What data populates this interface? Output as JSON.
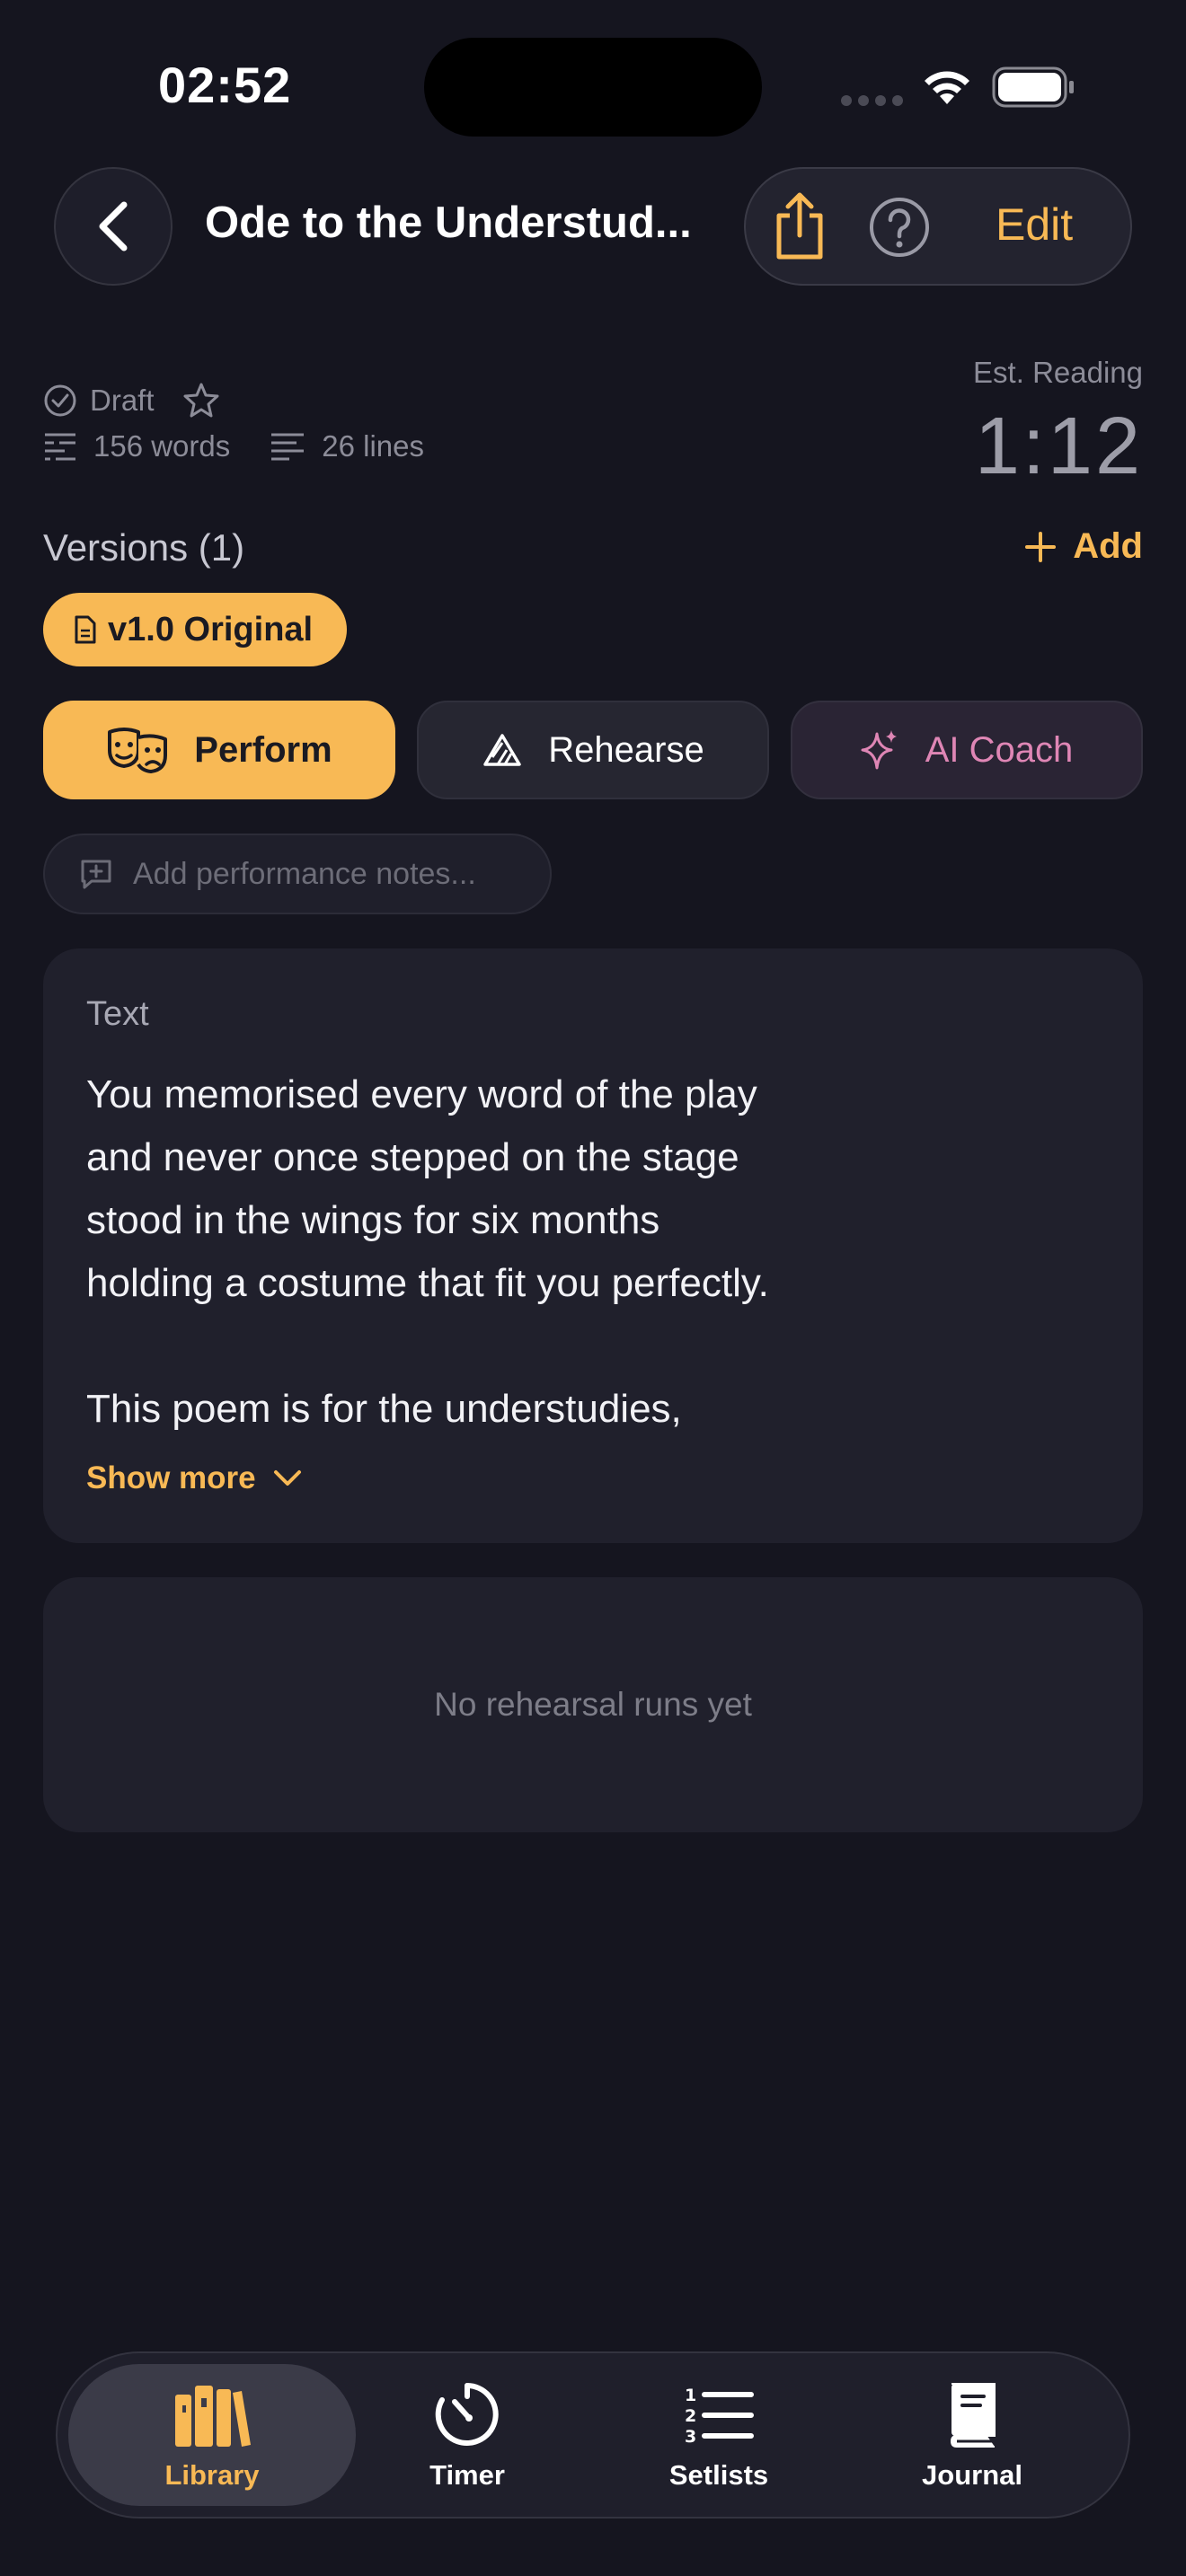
{
  "status_bar": {
    "time": "02:52"
  },
  "nav": {
    "title": "Ode to the Understud...",
    "edit_label": "Edit"
  },
  "meta": {
    "status": "Draft",
    "words": "156 words",
    "lines": "26 lines",
    "est_reading_label": "Est. Reading",
    "est_reading_value": "1:12"
  },
  "versions": {
    "title": "Versions (1)",
    "add_label": "Add",
    "items": [
      {
        "label": "v1.0 Original"
      }
    ]
  },
  "actions": {
    "perform": "Perform",
    "rehearse": "Rehearse",
    "ai_coach": "AI Coach"
  },
  "notes_placeholder": "Add performance notes...",
  "text_card": {
    "label": "Text",
    "lines": [
      "You memorised every word of the play",
      "and never once stepped on the stage",
      "stood in the wings for six months",
      "holding a costume that fit you perfectly.",
      "",
      "This poem is for the understudies,"
    ],
    "show_more": "Show more"
  },
  "runs_empty": "No rehearsal runs yet",
  "tabbar": {
    "items": [
      {
        "label": "Library",
        "icon": "books-icon",
        "active": true
      },
      {
        "label": "Timer",
        "icon": "timer-icon",
        "active": false
      },
      {
        "label": "Setlists",
        "icon": "numbered-list-icon",
        "active": false
      },
      {
        "label": "Journal",
        "icon": "journal-book-icon",
        "active": false
      }
    ]
  },
  "colors": {
    "background": "#15151f",
    "accent": "#f8b955",
    "card": "#20202c",
    "ai_coach": "#df86b5"
  }
}
